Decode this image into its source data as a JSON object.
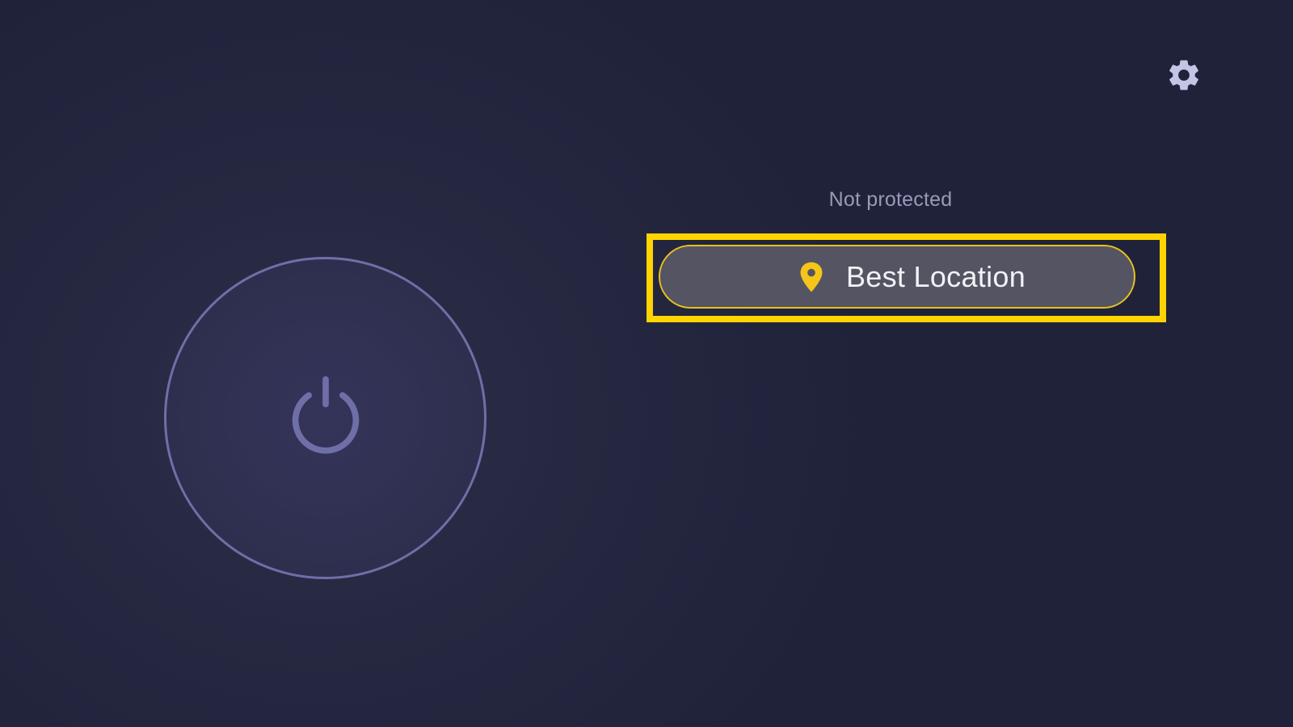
{
  "status": {
    "text": "Not protected"
  },
  "location": {
    "label": "Best Location",
    "icon": "map-pin-icon"
  },
  "settings": {
    "icon": "gear-icon"
  },
  "power": {
    "icon": "power-icon"
  },
  "colors": {
    "background": "#20223a",
    "ring": "#6f6fa8",
    "highlight": "#ffd400",
    "pin": "#f5c518",
    "gear": "#c4c4e6",
    "status_text": "#9a9ab8"
  }
}
